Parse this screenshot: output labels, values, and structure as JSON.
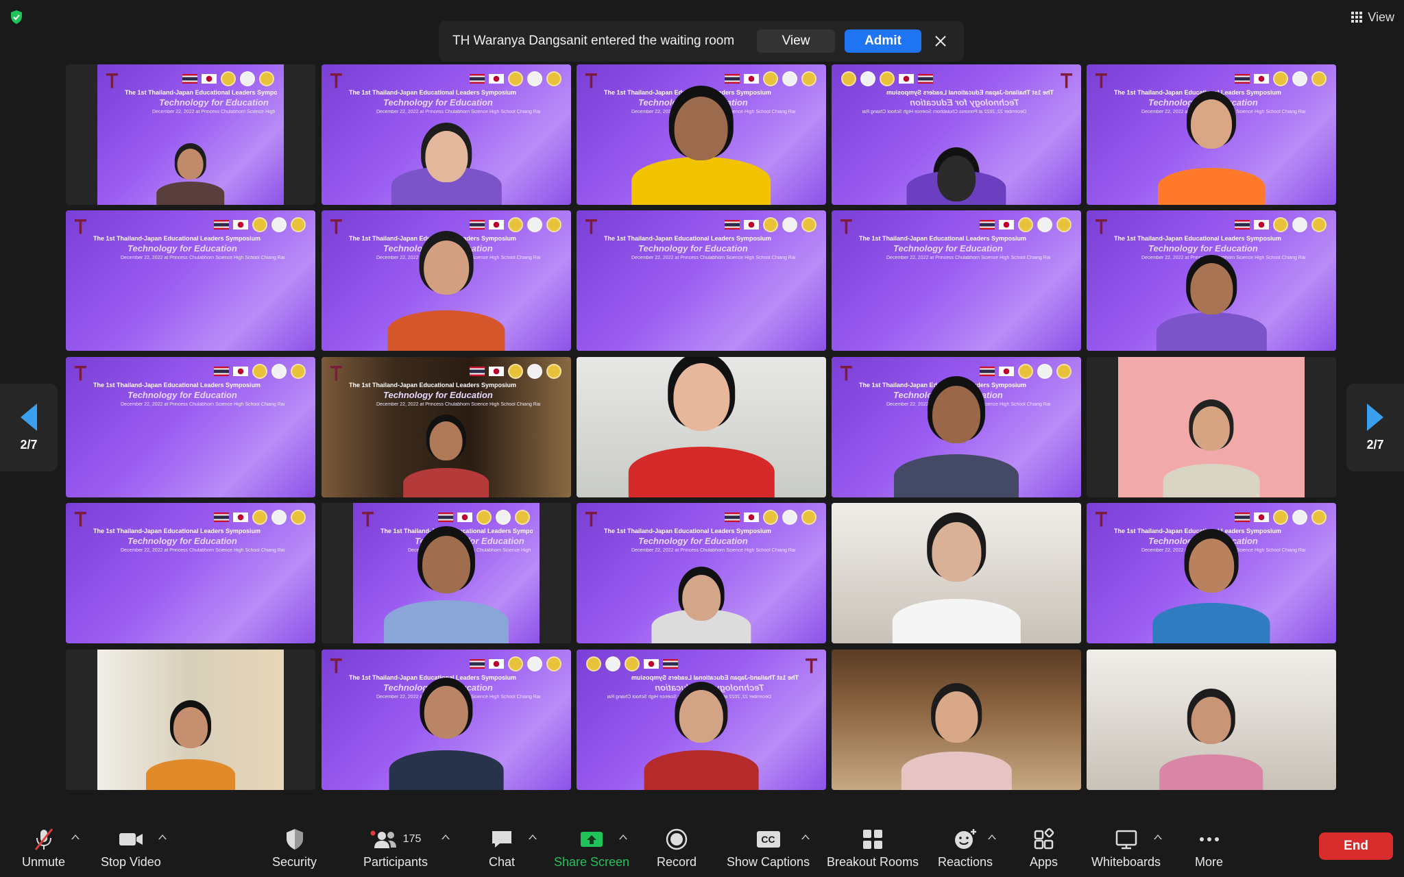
{
  "top": {
    "view_label": "View"
  },
  "notification": {
    "message": "TH Waranya Dangsanit entered the waiting room",
    "view_label": "View",
    "admit_label": "Admit"
  },
  "banner": {
    "line1": "The 1st Thailand-Japan Educational Leaders Symposium",
    "line2": "Technology for Education",
    "line3": "December 22, 2022 at Princess Chulabhorn Science High School Chiang Rai"
  },
  "pagination": {
    "left_label": "2/7",
    "right_label": "2/7"
  },
  "toolbar": {
    "unmute": "Unmute",
    "stop_video": "Stop Video",
    "security": "Security",
    "participants": "Participants",
    "participant_count": "175",
    "chat": "Chat",
    "share_screen": "Share Screen",
    "record": "Record",
    "show_captions": "Show Captions",
    "captions_badge": "CC",
    "breakout_rooms": "Breakout Rooms",
    "reactions": "Reactions",
    "apps": "Apps",
    "whiteboards": "Whiteboards",
    "more": "More",
    "end": "End"
  },
  "colors": {
    "accent_blue": "#1e74f2",
    "share_green": "#20c25a",
    "end_red": "#d92d2d",
    "arrow_blue": "#3aa0ee"
  },
  "icons": [
    "shield-check-icon",
    "grid-view-icon",
    "close-icon",
    "chevron-left-icon",
    "chevron-right-icon",
    "microphone-muted-icon",
    "video-camera-icon",
    "security-shield-icon",
    "participants-icon",
    "chat-bubble-icon",
    "share-screen-icon",
    "record-icon",
    "captions-icon",
    "breakout-rooms-icon",
    "reactions-icon",
    "apps-icon",
    "whiteboard-icon",
    "more-dots-icon",
    "caret-up-icon"
  ]
}
